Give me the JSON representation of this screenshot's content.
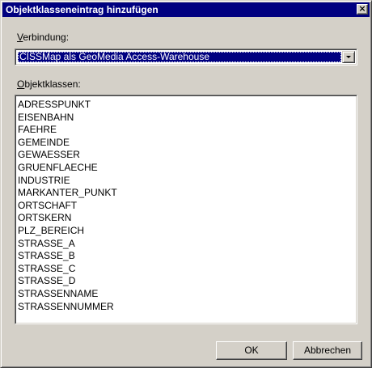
{
  "window": {
    "title": "Objektklasseneintrag hinzufügen",
    "close_glyph": "×"
  },
  "connection": {
    "label_accel": "V",
    "label_rest": "erbindung:",
    "selected": "CISSMap als GeoMedia Access-Warehouse"
  },
  "classes": {
    "label_accel": "O",
    "label_rest": "bjektklassen:",
    "items": [
      "ADRESSPUNKT",
      "EISENBAHN",
      "FAEHRE",
      "GEMEINDE",
      "GEWAESSER",
      "GRUENFLAECHE",
      "INDUSTRIE",
      "MARKANTER_PUNKT",
      "ORTSCHAFT",
      "ORTSKERN",
      "PLZ_BEREICH",
      "STRASSE_A",
      "STRASSE_B",
      "STRASSE_C",
      "STRASSE_D",
      "STRASSENNAME",
      "STRASSENNUMMER"
    ]
  },
  "buttons": {
    "ok": "OK",
    "cancel": "Abbrechen"
  },
  "colors": {
    "titlebar": "#000080",
    "face": "#d4d0c8",
    "selection": "#000080"
  },
  "icons": {
    "close": "close-icon",
    "dropdown": "chevron-down-icon"
  }
}
